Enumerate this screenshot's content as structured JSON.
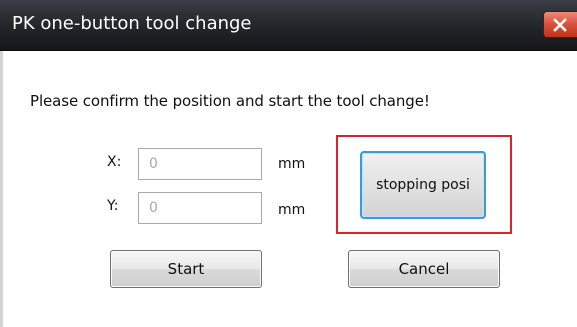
{
  "window": {
    "title": "PK one-button tool change",
    "close_icon": "close-icon"
  },
  "dialog": {
    "instruction": "Please confirm the position and start the tool change!",
    "x": {
      "label": "X:",
      "value": "0",
      "unit": "mm"
    },
    "y": {
      "label": "Y:",
      "value": "0",
      "unit": "mm"
    },
    "stop_button_label": "stopping posi",
    "start_button_label": "Start",
    "cancel_button_label": "Cancel"
  },
  "colors": {
    "titlebar": "#25282c",
    "close_button": "#d9503a",
    "highlight": "#d9232d",
    "focus_border": "#3c9ad8"
  }
}
